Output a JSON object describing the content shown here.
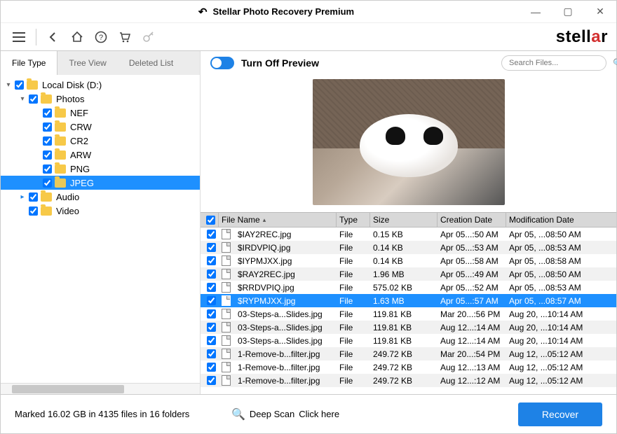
{
  "window": {
    "title": "Stellar Photo Recovery Premium"
  },
  "brand": {
    "name_prefix": "stell",
    "name_red": "a",
    "name_suffix": "r"
  },
  "tabs": [
    "File Type",
    "Tree View",
    "Deleted List"
  ],
  "activeTab": 0,
  "tree": [
    {
      "indent": 0,
      "caret": "▾",
      "checked": true,
      "label": "Local Disk (D:)"
    },
    {
      "indent": 1,
      "caret": "▾",
      "checked": true,
      "label": "Photos"
    },
    {
      "indent": 2,
      "caret": "",
      "checked": true,
      "label": "NEF"
    },
    {
      "indent": 2,
      "caret": "",
      "checked": true,
      "label": "CRW"
    },
    {
      "indent": 2,
      "caret": "",
      "checked": true,
      "label": "CR2"
    },
    {
      "indent": 2,
      "caret": "",
      "checked": true,
      "label": "ARW"
    },
    {
      "indent": 2,
      "caret": "",
      "checked": true,
      "label": "PNG"
    },
    {
      "indent": 2,
      "caret": "",
      "checked": true,
      "label": "JPEG",
      "selected": true
    },
    {
      "indent": 1,
      "caret": "▸",
      "checked": true,
      "label": "Audio",
      "caretColor": "#1e82e6"
    },
    {
      "indent": 1,
      "caret": "",
      "checked": true,
      "label": "Video"
    }
  ],
  "preview": {
    "toggleLabel": "Turn Off Preview"
  },
  "search": {
    "placeholder": "Search Files..."
  },
  "columns": {
    "name": "File Name",
    "type": "Type",
    "size": "Size",
    "cdate": "Creation Date",
    "mdate": "Modification Date"
  },
  "rows": [
    {
      "chk": true,
      "name": "$IAY2REC.jpg",
      "type": "File",
      "size": "0.15 KB",
      "cdate": "Apr 05...:50 AM",
      "mdate": "Apr 05, ...08:50 AM"
    },
    {
      "chk": true,
      "name": "$IRDVPIQ.jpg",
      "type": "File",
      "size": "0.14 KB",
      "cdate": "Apr 05...:53 AM",
      "mdate": "Apr 05, ...08:53 AM"
    },
    {
      "chk": true,
      "name": "$IYPMJXX.jpg",
      "type": "File",
      "size": "0.14 KB",
      "cdate": "Apr 05...:58 AM",
      "mdate": "Apr 05, ...08:58 AM"
    },
    {
      "chk": true,
      "name": "$RAY2REC.jpg",
      "type": "File",
      "size": "1.96 MB",
      "cdate": "Apr 05...:49 AM",
      "mdate": "Apr 05, ...08:50 AM"
    },
    {
      "chk": true,
      "name": "$RRDVPIQ.jpg",
      "type": "File",
      "size": "575.02 KB",
      "cdate": "Apr 05...:52 AM",
      "mdate": "Apr 05, ...08:53 AM"
    },
    {
      "chk": true,
      "name": "$RYPMJXX.jpg",
      "type": "File",
      "size": "1.63 MB",
      "cdate": "Apr 05...:57 AM",
      "mdate": "Apr 05, ...08:57 AM",
      "selected": true
    },
    {
      "chk": true,
      "name": "03-Steps-a...Slides.jpg",
      "type": "File",
      "size": "119.81 KB",
      "cdate": "Mar 20...:56 PM",
      "mdate": "Aug 20, ...10:14 AM"
    },
    {
      "chk": true,
      "name": "03-Steps-a...Slides.jpg",
      "type": "File",
      "size": "119.81 KB",
      "cdate": "Aug 12...:14 AM",
      "mdate": "Aug 20, ...10:14 AM"
    },
    {
      "chk": true,
      "name": "03-Steps-a...Slides.jpg",
      "type": "File",
      "size": "119.81 KB",
      "cdate": "Aug 12...:14 AM",
      "mdate": "Aug 20, ...10:14 AM"
    },
    {
      "chk": true,
      "name": "1-Remove-b...filter.jpg",
      "type": "File",
      "size": "249.72 KB",
      "cdate": "Mar 20...:54 PM",
      "mdate": "Aug 12, ...05:12 AM"
    },
    {
      "chk": true,
      "name": "1-Remove-b...filter.jpg",
      "type": "File",
      "size": "249.72 KB",
      "cdate": "Aug 12...:13 AM",
      "mdate": "Aug 12, ...05:12 AM"
    },
    {
      "chk": true,
      "name": "1-Remove-b...filter.jpg",
      "type": "File",
      "size": "249.72 KB",
      "cdate": "Aug 12...:12 AM",
      "mdate": "Aug 12, ...05:12 AM"
    }
  ],
  "status": {
    "marked": "Marked 16.02 GB in 4135 files in 16 folders",
    "deepScan": "Deep Scan",
    "clickHere": "Click here",
    "recover": "Recover"
  }
}
